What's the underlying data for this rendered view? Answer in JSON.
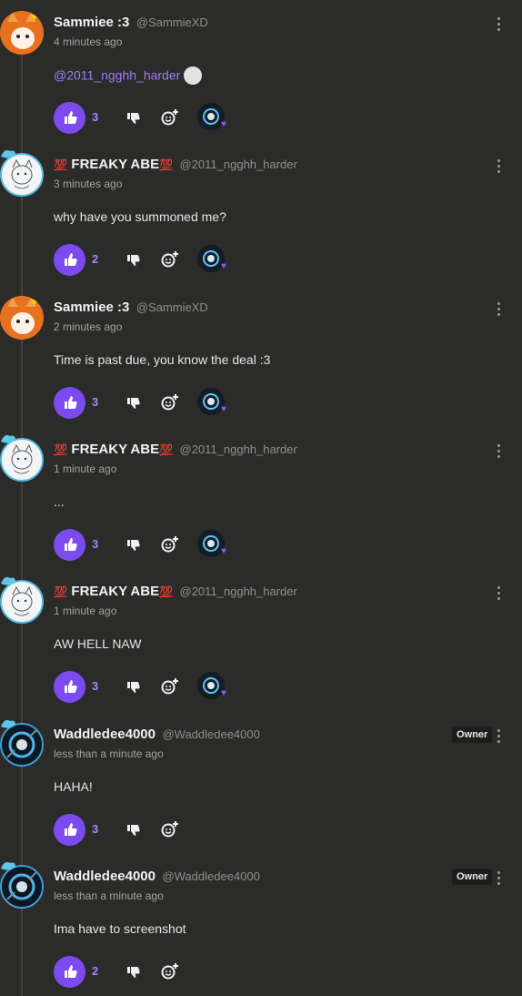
{
  "labels": {
    "owner": "Owner"
  },
  "comments": [
    {
      "name": "Sammiee :3",
      "handle": "@SammieXD",
      "time": "4 minutes ago",
      "mention": "@2011_ngghh_harder",
      "text": "",
      "likes": "3",
      "avatar": "cat",
      "owner": false,
      "creator_heart": true
    },
    {
      "name_prefix": "💯",
      "name": "FREAKY ABE",
      "name_suffix": "💯",
      "handle": "@2011_ngghh_harder",
      "time": "3 minutes ago",
      "text": "why have you summoned me?",
      "likes": "2",
      "avatar": "sketch",
      "owner": false,
      "creator_heart": true
    },
    {
      "name": "Sammiee :3",
      "handle": "@SammieXD",
      "time": "2 minutes ago",
      "text": "Time is past due, you know the deal :3",
      "likes": "3",
      "avatar": "cat",
      "owner": false,
      "creator_heart": true
    },
    {
      "name_prefix": "💯",
      "name": "FREAKY ABE",
      "name_suffix": "💯",
      "handle": "@2011_ngghh_harder",
      "time": "1 minute ago",
      "text": "...",
      "likes": "3",
      "avatar": "sketch",
      "owner": false,
      "creator_heart": true
    },
    {
      "name_prefix": "💯",
      "name": "FREAKY ABE",
      "name_suffix": "💯",
      "handle": "@2011_ngghh_harder",
      "time": "1 minute ago",
      "text": "AW HELL NAW",
      "likes": "3",
      "avatar": "sketch",
      "owner": false,
      "creator_heart": true
    },
    {
      "name": "Waddledee4000",
      "handle": "@Waddledee4000",
      "time": "less than a minute ago",
      "text": "HAHA!",
      "likes": "3",
      "avatar": "waddle",
      "owner": true,
      "creator_heart": false
    },
    {
      "name": "Waddledee4000",
      "handle": "@Waddledee4000",
      "time": "less than a minute ago",
      "text": "Ima have to screenshot",
      "likes": "2",
      "avatar": "waddle",
      "owner": true,
      "creator_heart": false
    }
  ],
  "icons": {
    "like": "thumbs-up-icon",
    "dislike": "thumbs-down-icon",
    "react": "add-reaction-icon",
    "more": "more-vertical-icon",
    "heart": "heart-icon"
  },
  "colors": {
    "accent": "#7b4bf0",
    "background": "#2b2b29",
    "mention": "#9f7cf5"
  }
}
